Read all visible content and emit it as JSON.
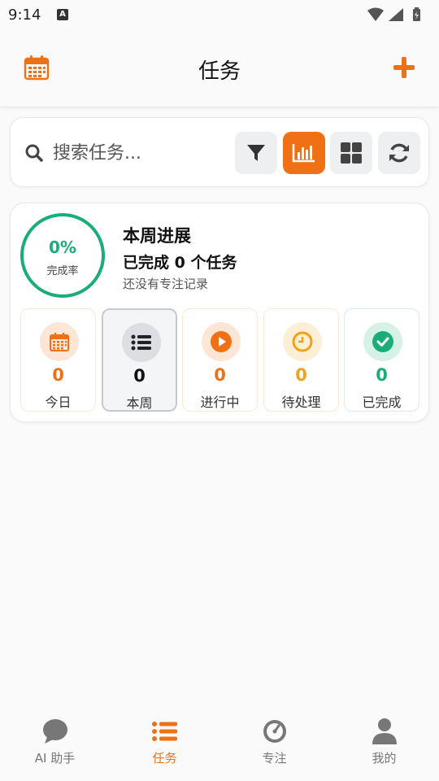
{
  "status_bar": {
    "time": "9:14",
    "notification_badge": "A"
  },
  "header": {
    "title": "任务",
    "calendar_icon": "calendar-icon",
    "add_icon": "plus-icon"
  },
  "search": {
    "placeholder": "搜索任务...",
    "value": "",
    "tools": [
      {
        "icon": "filter-icon",
        "active": false
      },
      {
        "icon": "bar-chart-icon",
        "active": true
      },
      {
        "icon": "grid-icon",
        "active": false
      },
      {
        "icon": "refresh-icon",
        "active": false
      }
    ]
  },
  "progress": {
    "completion_rate": "0%",
    "completion_label": "完成率",
    "title": "本周进展",
    "completed_text": "已完成 0 个任务",
    "focus_text": "还没有专注记录",
    "stats": [
      {
        "label": "今日",
        "count": "0",
        "icon": "calendar-icon",
        "color": "#f07016"
      },
      {
        "label": "本周",
        "count": "0",
        "icon": "list-icon",
        "color": "#111111",
        "selected": true
      },
      {
        "label": "进行中",
        "count": "0",
        "icon": "play-circle-icon",
        "color": "#f07016"
      },
      {
        "label": "待处理",
        "count": "0",
        "icon": "clock-icon",
        "color": "#f0a11a"
      },
      {
        "label": "已完成",
        "count": "0",
        "icon": "check-circle-icon",
        "color": "#1aad7a"
      }
    ]
  },
  "bottom_nav": {
    "items": [
      {
        "label": "AI 助手",
        "icon": "chat-bubble-icon",
        "active": false
      },
      {
        "label": "任务",
        "icon": "list-icon",
        "active": true
      },
      {
        "label": "专注",
        "icon": "timer-icon",
        "active": false
      },
      {
        "label": "我的",
        "icon": "user-icon",
        "active": false
      }
    ]
  },
  "colors": {
    "accent": "#f07016",
    "success": "#1aad7a",
    "pending": "#f0a11a"
  }
}
